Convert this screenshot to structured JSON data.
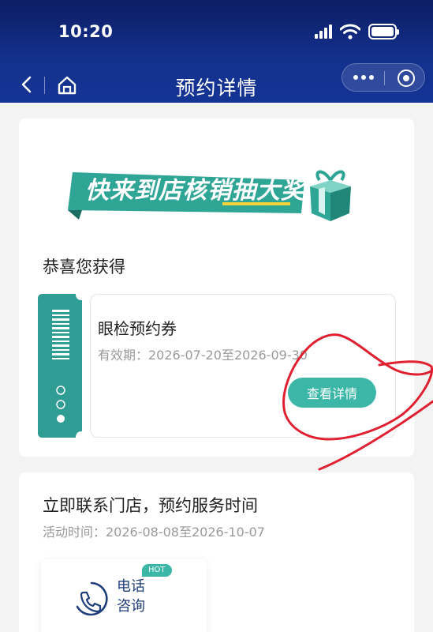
{
  "status_bar": {
    "time": "10:20"
  },
  "nav": {
    "title": "预约详情"
  },
  "banner": {
    "text": "快来到店核销抽大奖"
  },
  "prize": {
    "congrats": "恭喜您获得",
    "coupon_name": "眼检预约券",
    "validity": "有效期：2026-07-20至2026-09-30",
    "detail_button": "查看详情"
  },
  "contact": {
    "title": "立即联系门店，预约服务时间",
    "activity": "活动时间：2026-08-08至2026-10-07",
    "call_label": "电话咨询",
    "hot_badge": "HOT"
  },
  "colors": {
    "header": "#13308c",
    "accent": "#3bb6a7",
    "annotation": "#e02030"
  }
}
